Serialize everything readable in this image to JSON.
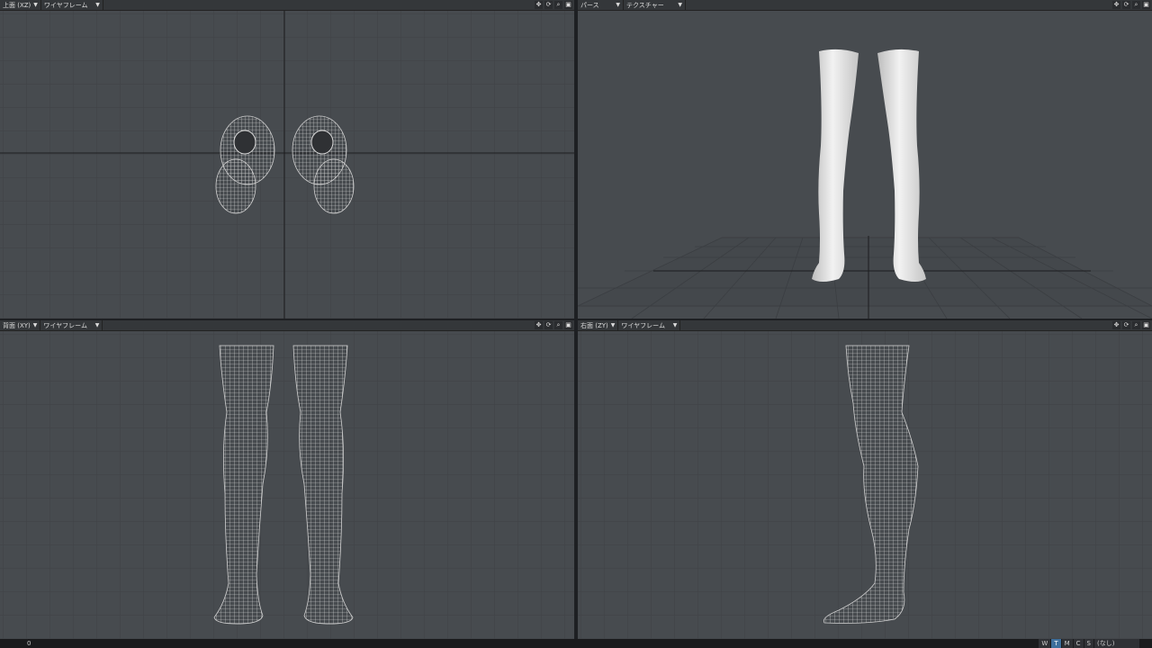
{
  "viewports": {
    "top": {
      "view_label": "上面 (XZ)",
      "shading_label": "ワイヤフレーム"
    },
    "perspective": {
      "view_label": "パース",
      "shading_label": "テクスチャー"
    },
    "back": {
      "view_label": "背面 (XY)",
      "shading_label": "ワイヤフレーム"
    },
    "right": {
      "view_label": "右面 (ZY)",
      "shading_label": "ワイヤフレーム"
    }
  },
  "tool_icons": [
    "move-icon",
    "rotate-icon",
    "zoom-icon",
    "maximize-icon"
  ],
  "status_bar": {
    "coordinate_readout": "0",
    "mode_buttons": [
      "W",
      "T",
      "M",
      "C",
      "S"
    ],
    "active_mode": "T",
    "surface_label": "(なし)"
  },
  "colors": {
    "viewport_bg": "#474b4f",
    "header_bg": "#34373a",
    "active_mode": "#3e6f9c",
    "wireframe": "#e6e6e6"
  }
}
